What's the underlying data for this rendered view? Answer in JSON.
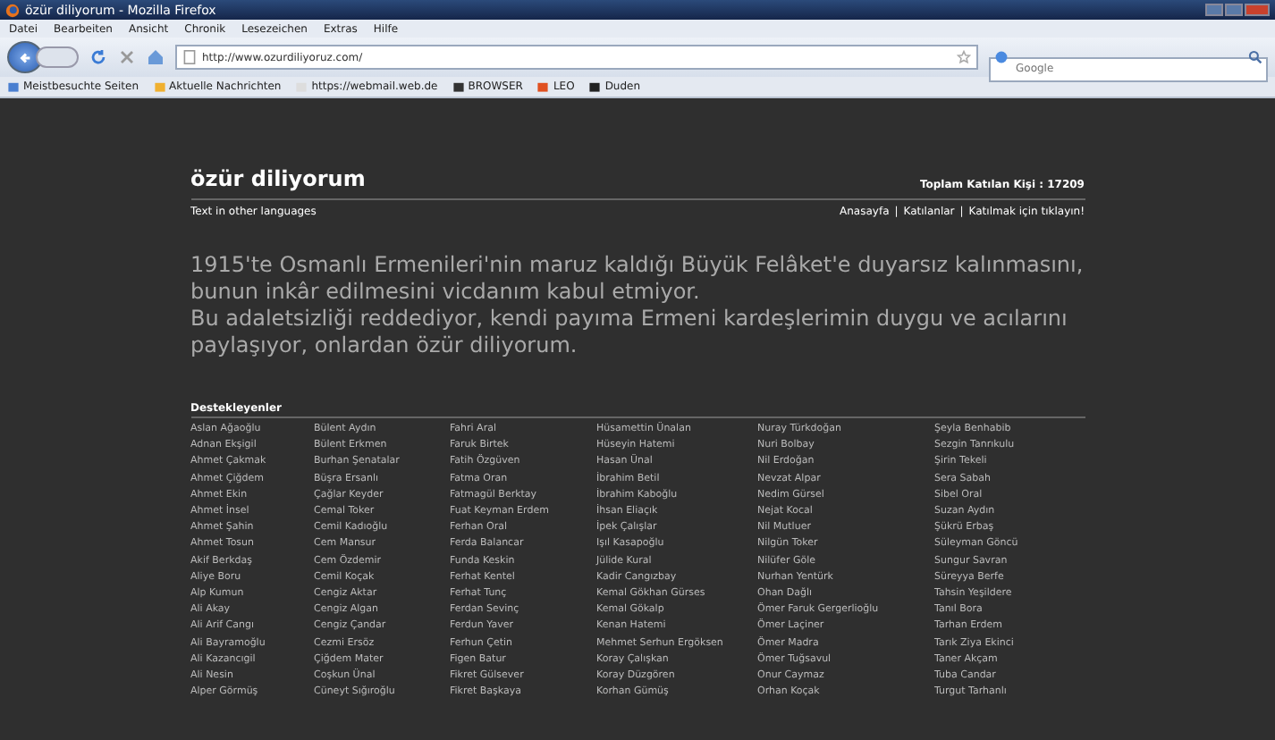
{
  "browser": {
    "title": "özür diliyorum - Mozilla Firefox",
    "menu": [
      "Datei",
      "Bearbeiten",
      "Ansicht",
      "Chronik",
      "Lesezeichen",
      "Extras",
      "Hilfe"
    ],
    "url": "http://www.ozurdiliyoruz.com/",
    "search_placeholder": "Google",
    "bookmarks": [
      "Meistbesuchte Seiten",
      "Aktuelle Nachrichten",
      "https://webmail.web.de",
      "BROWSER",
      "LEO",
      "Duden"
    ]
  },
  "page": {
    "site_title": "özür diliyorum",
    "total": "Toplam Katılan Kişi : 17209",
    "other_languages": "Text in other languages",
    "nav_links": [
      "Anasayfa",
      "Katılanlar",
      "Katılmak için tıklayın!"
    ],
    "nav_separator": "|",
    "statement": [
      "1915'te Osmanlı Ermenileri'nin maruz kaldığı Büyük Felâket'e duyarsız kalınmasını, bunun inkâr edilmesini vicdanım kabul etmiyor.",
      "Bu adaletsizliği reddediyor, kendi payıma Ermeni kardeşlerimin duygu ve acılarını paylaşıyor, onlardan özür diliyorum."
    ],
    "list_heading": "Destekleyenler",
    "columns": [
      [
        "Aslan Ağaoğlu",
        "Adnan Ekşigil",
        "Ahmet Çakmak",
        "Ahmet Çiğdem",
        "Ahmet Ekin",
        "Ahmet İnsel",
        "Ahmet Şahin",
        "Ahmet Tosun",
        "Akif Berkdaş",
        "Aliye Boru",
        "Alp Kumun",
        "Ali Akay",
        "Ali Arif Cangı",
        "Ali Bayramoğlu",
        "Ali Kazancıgil",
        "Ali Nesin",
        "Alper Görmüş"
      ],
      [
        "Bülent Aydın",
        "Bülent Erkmen",
        "Burhan Şenatalar",
        "Büşra Ersanlı",
        "Çağlar Keyder",
        "Cemal Toker",
        "Cemil Kadıoğlu",
        "Cem Mansur",
        "Cem Özdemir",
        "Cemil Koçak",
        "Cengiz Aktar",
        "Cengiz Algan",
        "Cengiz Çandar",
        "Cezmi Ersöz",
        "Çiğdem Mater",
        "Coşkun Ünal",
        "Cüneyt Sığıroğlu"
      ],
      [
        "Fahri Aral",
        "Faruk Birtek",
        "Fatih Özgüven",
        "Fatma Oran",
        "Fatmagül Berktay",
        "Fuat Keyman Erdem",
        "Ferhan Oral",
        "Ferda Balancar",
        "Funda Keskin",
        "Ferhat Kentel",
        "Ferhat Tunç",
        "Ferdan Sevinç",
        "Ferdun Yaver",
        "Ferhun Çetin",
        "Figen Batur",
        "Fikret Gülsever",
        "Fikret Başkaya"
      ],
      [
        "Hüsamettin Ünalan",
        "Hüseyin Hatemi",
        "Hasan Ünal",
        "İbrahim Betil",
        "İbrahim Kaboğlu",
        "İhsan Eliaçık",
        "İpek Çalışlar",
        "Işıl Kasapoğlu",
        "Jülide Kural",
        "Kadir Cangızbay",
        "Kemal Gökhan Gürses",
        "Kemal Gökalp",
        "Kenan Hatemi",
        "Mehmet Serhun Ergöksen",
        "Koray Çalışkan",
        "Koray Düzgören",
        "Korhan Gümüş"
      ],
      [
        "Nuray Türkdoğan",
        "Nuri Bolbay",
        "Nil Erdoğan",
        "Nevzat Alpar",
        "Nedim Gürsel",
        "Nejat Kocal",
        "Nil Mutluer",
        "Nilgün Toker",
        "Nilüfer Göle",
        "Nurhan Yentürk",
        "Ohan Dağlı",
        "Ömer Faruk Gergerlioğlu",
        "Ömer Laçiner",
        "Ömer Madra",
        "Ömer Tuğsavul",
        "Onur Caymaz",
        "Orhan Koçak"
      ],
      [
        "Şeyla Benhabib",
        "Sezgin Tanrıkulu",
        "Şirin Tekeli",
        "Sera Sabah",
        "Sibel Oral",
        "Suzan Aydın",
        "Şükrü Erbaş",
        "Süleyman Göncü",
        "Sungur Savran",
        "Süreyya Berfe",
        "Tahsin Yeşildere",
        "Tanıl Bora",
        "Tarhan Erdem",
        "Tarık Ziya Ekinci",
        "Taner Akçam",
        "Tuba Candar",
        "Turgut Tarhanlı"
      ]
    ]
  }
}
